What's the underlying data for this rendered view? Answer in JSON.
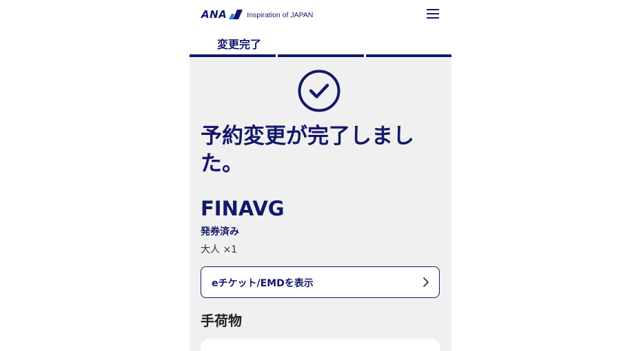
{
  "header": {
    "logo_text": "ANA",
    "tagline": "Inspiration of JAPAN"
  },
  "stepbar": {
    "current_step": "変更完了",
    "step_count": 3
  },
  "confirmation": {
    "headline": "予約変更が完了しました。"
  },
  "booking": {
    "pnr": "FINAVG",
    "ticket_status": "発券済み",
    "passengers": "大人 ×1",
    "eticket_button": "eチケット/EMDを表示"
  },
  "baggage": {
    "section_title": "手荷物"
  },
  "colors": {
    "brand_navy": "#13176a",
    "background": "#f0f0f0"
  },
  "icons": [
    "ana-logo-icon",
    "hamburger-menu-icon",
    "check-circle-icon",
    "chevron-right-icon"
  ]
}
